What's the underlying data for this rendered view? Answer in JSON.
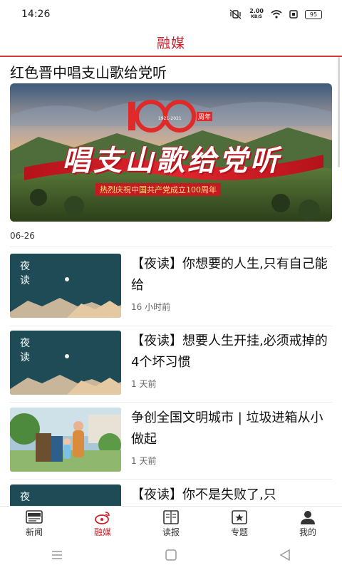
{
  "status_bar": {
    "time": "14:26",
    "net_speed": "2.00",
    "net_unit": "KB/S",
    "battery": "95",
    "icons": [
      "mute-vibrate-icon",
      "wifi-icon",
      "sim-icon",
      "battery-icon"
    ]
  },
  "header": {
    "title": "融媒"
  },
  "featured": {
    "title": "红色晋中唱支山歌给党听",
    "banner": {
      "logo_number": "100",
      "logo_years": "1921-2021",
      "logo_suffix": "周年",
      "calligraphy": "唱支山歌给党听",
      "ribbon_text": "热烈庆祝中国共产党成立100周年"
    }
  },
  "date_label": "06-26",
  "news": [
    {
      "title": "【夜读】你想要的人生,只有自己能给",
      "time": "16 小时前",
      "thumb_text": "夜读",
      "thumb": "night-read"
    },
    {
      "title": "【夜读】想要人生开挂,必须戒掉的4个坏习惯",
      "time": "1 天前",
      "thumb_text": "夜读",
      "thumb": "night-read"
    },
    {
      "title": "争创全国文明城市 | 垃圾进箱从小做起",
      "time": "1 天前",
      "thumb": "photo-park"
    },
    {
      "title": "【夜读】你不是失败了,只",
      "time": "",
      "thumb_text": "夜读",
      "thumb": "night-read"
    }
  ],
  "tabs": [
    {
      "label": "新闻",
      "icon": "news-icon",
      "active": false
    },
    {
      "label": "融媒",
      "icon": "media-icon",
      "active": true
    },
    {
      "label": "读报",
      "icon": "newspaper-icon",
      "active": false
    },
    {
      "label": "专题",
      "icon": "topic-icon",
      "active": false
    },
    {
      "label": "我的",
      "icon": "profile-icon",
      "active": false
    }
  ],
  "colors": {
    "accent": "#d0202a",
    "night_bg": "#1e4b55",
    "text": "#111111"
  },
  "system_nav": [
    "menu-icon",
    "home-icon",
    "back-icon"
  ]
}
